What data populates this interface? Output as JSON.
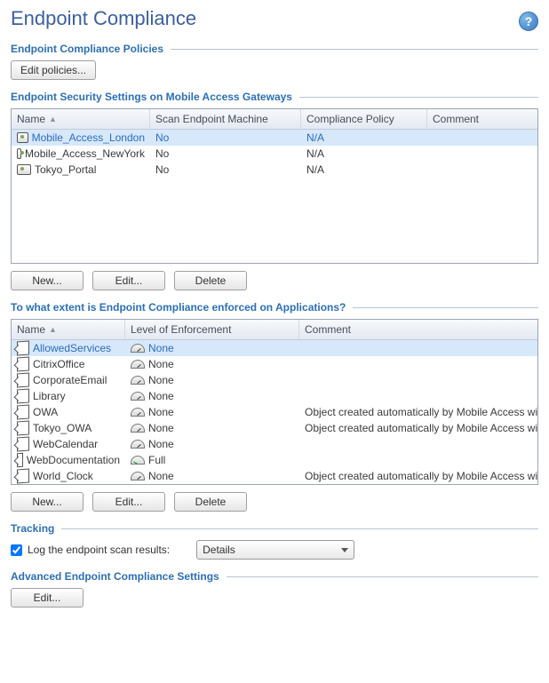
{
  "title": "Endpoint Compliance",
  "sections": {
    "policies": {
      "title": "Endpoint Compliance Policies",
      "edit_btn": "Edit policies..."
    },
    "gateways": {
      "title": "Endpoint Security Settings on Mobile Access Gateways",
      "columns": {
        "name": "Name",
        "scan": "Scan Endpoint Machine",
        "policy": "Compliance Policy",
        "comment": "Comment"
      },
      "rows": [
        {
          "name": "Mobile_Access_London",
          "scan": "No",
          "policy": "N/A",
          "comment": ""
        },
        {
          "name": "Mobile_Access_NewYork",
          "scan": "No",
          "policy": "N/A",
          "comment": ""
        },
        {
          "name": "Tokyo_Portal",
          "scan": "No",
          "policy": "N/A",
          "comment": ""
        }
      ],
      "buttons": {
        "new": "New...",
        "edit": "Edit...",
        "delete": "Delete"
      }
    },
    "apps": {
      "title": "To what extent is Endpoint Compliance enforced on Applications?",
      "columns": {
        "name": "Name",
        "level": "Level of Enforcement",
        "comment": "Comment"
      },
      "rows": [
        {
          "name": "AllowedServices",
          "level": "None",
          "comment": ""
        },
        {
          "name": "CitrixOffice",
          "level": "None",
          "comment": ""
        },
        {
          "name": "CorporateEmail",
          "level": "None",
          "comment": ""
        },
        {
          "name": "Library",
          "level": "None",
          "comment": ""
        },
        {
          "name": "OWA",
          "level": "None",
          "comment": "Object created automatically by Mobile Access wizard."
        },
        {
          "name": "Tokyo_OWA",
          "level": "None",
          "comment": "Object created automatically by Mobile Access wizard."
        },
        {
          "name": "WebCalendar",
          "level": "None",
          "comment": ""
        },
        {
          "name": "WebDocumentation",
          "level": "Full",
          "comment": ""
        },
        {
          "name": "World_Clock",
          "level": "None",
          "comment": "Object created automatically by Mobile Access wizard."
        }
      ],
      "buttons": {
        "new": "New...",
        "edit": "Edit...",
        "delete": "Delete"
      }
    },
    "tracking": {
      "title": "Tracking",
      "checkbox_label": "Log the endpoint scan results:",
      "checked": true,
      "select_value": "Details"
    },
    "advanced": {
      "title": "Advanced Endpoint Compliance Settings",
      "edit_btn": "Edit..."
    }
  }
}
